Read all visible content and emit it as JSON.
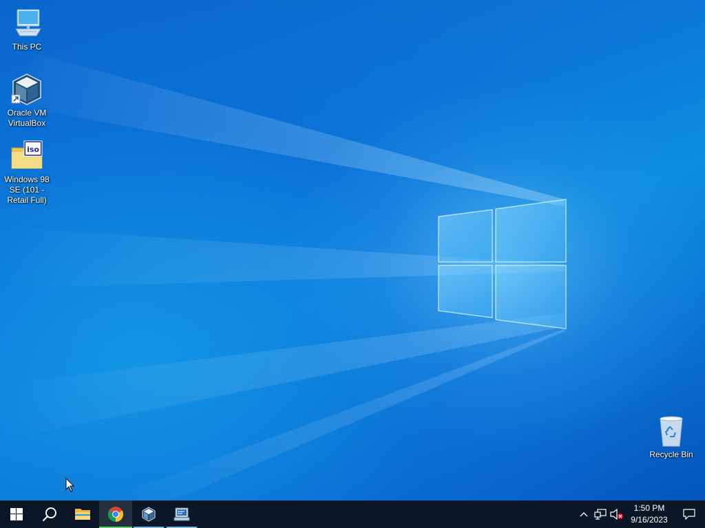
{
  "desktop": {
    "icons": [
      {
        "label": "This PC",
        "icon": "computer-icon"
      },
      {
        "label": "Oracle VM VirtualBox",
        "icon": "virtualbox-icon"
      },
      {
        "label": "Windows 98 SE (101 - Retail Full)",
        "icon": "iso-file-icon"
      },
      {
        "label": "Recycle Bin",
        "icon": "recycle-bin-icon"
      }
    ]
  },
  "taskbar": {
    "buttons": [
      {
        "name": "Start",
        "icon": "windows-logo-icon"
      },
      {
        "name": "Search",
        "icon": "search-icon"
      },
      {
        "name": "File Explorer",
        "icon": "folder-icon"
      },
      {
        "name": "Google Chrome",
        "icon": "chrome-icon",
        "state": "active"
      },
      {
        "name": "Oracle VM VirtualBox",
        "icon": "virtualbox-icon",
        "state": "running"
      },
      {
        "name": "Remote Desktop",
        "icon": "remote-desktop-icon",
        "state": "running"
      }
    ],
    "tray": {
      "icons": [
        "chevron-up-icon",
        "network-icon",
        "volume-muted-icon"
      ],
      "time": "1:50 PM",
      "date": "9/16/2023",
      "notification_icon": "action-center-icon"
    }
  },
  "colors": {
    "taskbar": "#0b1626",
    "desktop_blue": "#0a74d4",
    "active_indicator": "#5ed16f",
    "running_indicator": "#76b9ed"
  }
}
